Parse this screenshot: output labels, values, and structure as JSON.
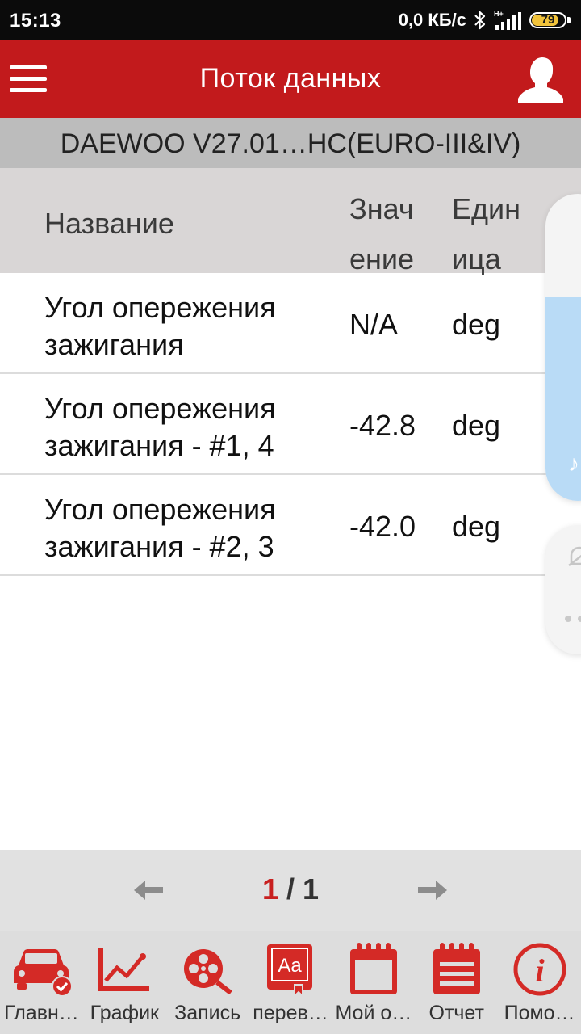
{
  "status_bar": {
    "time": "15:13",
    "network_speed": "0,0 КБ/с",
    "battery_level": "79",
    "battery_fraction": 0.79
  },
  "app_bar": {
    "title": "Поток данных"
  },
  "vehicle": {
    "label": "DAEWOO V27.01…HC(EURO-III&IV)"
  },
  "table": {
    "headers": {
      "name": "Название",
      "value_line1": "Знач",
      "value_line2": "ение",
      "unit_line1": "Един",
      "unit_line2": "ица"
    },
    "rows": [
      {
        "name_line1": "Угол опережения",
        "name_line2": "зажигания",
        "value": "N/A",
        "unit": "deg"
      },
      {
        "name_line1": "Угол опережения",
        "name_line2": "зажигания - #1, 4",
        "value": "-42.8",
        "unit": "deg"
      },
      {
        "name_line1": "Угол опережения",
        "name_line2": "зажигания - #2, 3",
        "value": "-42.0",
        "unit": "deg"
      }
    ]
  },
  "pagination": {
    "current": "1",
    "separator": " / ",
    "total": "1"
  },
  "bottom_nav": [
    {
      "label": "Главн…",
      "icon": "car-check-icon"
    },
    {
      "label": "График",
      "icon": "line-chart-icon"
    },
    {
      "label": "Запись",
      "icon": "film-reel-search-icon"
    },
    {
      "label": "перев…",
      "icon": "translate-book-icon"
    },
    {
      "label": "Мой о…",
      "icon": "calendar-icon"
    },
    {
      "label": "Отчет",
      "icon": "report-icon"
    },
    {
      "label": "Помо…",
      "icon": "info-icon"
    }
  ],
  "colors": {
    "accent_red": "#c21a1c",
    "status_bar": "#0b0b0b",
    "vehicle_bar": "#bcbcbc",
    "table_header": "#d9d6d6",
    "pager_bg": "#e1e1e1",
    "nav_bg": "#dddddd"
  }
}
